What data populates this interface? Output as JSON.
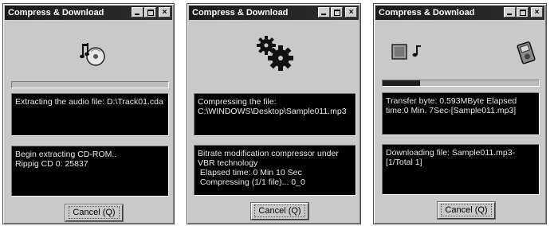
{
  "windows": [
    {
      "title": "Compress & Download",
      "panel1_lines": [
        "Extracting the audio file: D:\\Track01.cda"
      ],
      "panel2_lines": [
        "Begin extracting CD-ROM..",
        "Rippig CD 0: 25837"
      ],
      "cancel_label": "Cancel (Q)",
      "progress": 0
    },
    {
      "title": "Compress & Download",
      "panel1_lines": [
        "Compressing the file:",
        "C:\\WINDOWS\\Desktop\\Sample011.mp3"
      ],
      "panel2_lines": [
        "Bitrate modification compressor under VBR technology",
        " Elapsed time: 0 Min 10 Sec",
        " Compressing (1/1 file)... 0_0"
      ],
      "cancel_label": "Cancel (Q)",
      "progress": null
    },
    {
      "title": "Compress & Download",
      "panel1_lines": [
        "Transfer byte: 0.593MByte Elapsed time:0 Min. 7Sec-[Sample011.mp3]"
      ],
      "panel2_lines": [
        "Downloading file: Sample011.mp3-[1/Total 1]"
      ],
      "cancel_label": "Cancel (Q)",
      "progress": 0.24
    }
  ],
  "colors": {
    "panel_bg": "#000000",
    "panel_text": "#e8e8e8",
    "window_bg": "#c9c9c9",
    "title_bg": "#1a1a1a"
  },
  "icons": [
    "cd-music-icon",
    "gears-icon",
    "media-transfer-icon",
    "device-icon"
  ]
}
